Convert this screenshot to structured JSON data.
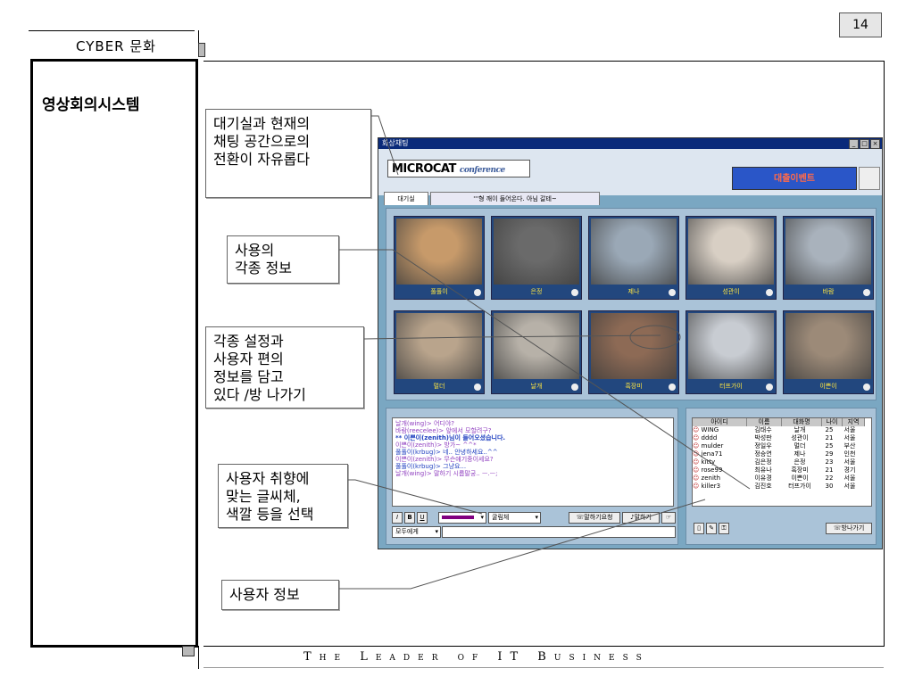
{
  "page_number": "14",
  "course_title": "CYBER 문화",
  "side_title": "영상회의시스템",
  "footer_text": "The Leader of IT Business",
  "callouts": {
    "switch": [
      "대기실과 현재의",
      "채팅 공간으로의",
      "전환이 자유롭다"
    ],
    "user_info_various": [
      "사용의",
      "각종 정보"
    ],
    "settings": [
      "각종 설정과",
      "사용자 편의",
      "정보를 담고",
      "있다 /방 나가기"
    ],
    "font_color": [
      "사용자 취향에",
      "맞는 글씨체,",
      "색깔 등을 선택"
    ],
    "user_info": [
      "사용자 정보"
    ]
  },
  "app": {
    "window_title": "화상채팅",
    "logo_main": "MICROCAT",
    "logo_sub": "conference",
    "banner_text": "대출이벤트",
    "tabs": [
      "대기실",
      "'''형 깨이 들어온다. 아님 갈테~"
    ],
    "videos": [
      {
        "name": "풀풀이",
        "tint": "#c79a6a"
      },
      {
        "name": "은정",
        "tint": "#6a6a6a"
      },
      {
        "name": "제나",
        "tint": "#9aa8b6"
      },
      {
        "name": "성관이",
        "tint": "#d8cfc4"
      },
      {
        "name": "바람",
        "tint": "#a9b2bc"
      },
      {
        "name": "멀더",
        "tint": "#b9a48c"
      },
      {
        "name": "날개",
        "tint": "#b7b1a8"
      },
      {
        "name": "흑장미",
        "tint": "#8d6a55"
      },
      {
        "name": "터프가이",
        "tint": "#c8ccd2"
      },
      {
        "name": "이쁜이",
        "tint": "#9c8a78"
      }
    ],
    "chat_lines": [
      {
        "text": "날개(wing)> 어디야?",
        "color": "#9040c0"
      },
      {
        "text": "바람(reecelee)> 앞에서 모할려구?",
        "color": "#9040c0"
      },
      {
        "text": "** 이쁜이(zenith)님이 들어오셨습니다.",
        "color": "#2040c0"
      },
      {
        "text": "이쁜이(zenith)> 방가~ ^^*",
        "color": "#9040c0"
      },
      {
        "text": "풀풀이(krbug)> 네.. 안녕하세요..^^",
        "color": "#2040c0"
      },
      {
        "text": "이쁜이(zenith)> 무슨얘기중이세요?",
        "color": "#9040c0"
      },
      {
        "text": "풀풀이(krbug)> 그냥요...",
        "color": "#2040c0"
      },
      {
        "text": "날개(wing)> 말하기 시롭말궁.. ㅡ.ㅡ;",
        "color": "#9040c0"
      }
    ],
    "toolbar": {
      "italic": "I",
      "bold": "B",
      "underline": "U",
      "font_select": "굴림체",
      "request_speak": "말하기요청",
      "speak": "말하기",
      "target_select": "모두에게",
      "exit_button": "방나가기"
    },
    "user_table": {
      "headers": [
        "아이디",
        "이름",
        "대화명",
        "나이",
        "지역"
      ],
      "rows": [
        [
          "WING",
          "김태수",
          "날개",
          "25",
          "서울"
        ],
        [
          "dddd",
          "박성판",
          "성관이",
          "21",
          "서울"
        ],
        [
          "mulder",
          "정일우",
          "멀더",
          "25",
          "부산"
        ],
        [
          "jena71",
          "정승연",
          "제나",
          "29",
          "인천"
        ],
        [
          "kitty",
          "김은정",
          "은정",
          "23",
          "서울"
        ],
        [
          "rose99",
          "최유나",
          "흑장미",
          "21",
          "경기"
        ],
        [
          "zenith",
          "이유경",
          "이쁜이",
          "22",
          "서울"
        ],
        [
          "killer3",
          "김진호",
          "터프가이",
          "30",
          "서울"
        ]
      ]
    }
  }
}
